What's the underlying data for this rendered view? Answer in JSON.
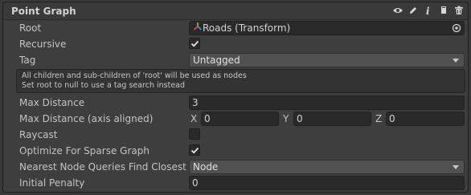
{
  "header": {
    "title": "Point Graph"
  },
  "fields": {
    "root": {
      "label": "Root",
      "value": "Roads (Transform)"
    },
    "recursive": {
      "label": "Recursive",
      "checked": true
    },
    "tag": {
      "label": "Tag",
      "value": "Untagged"
    },
    "help": {
      "line1": "All children and sub-children of 'root' will be used as nodes",
      "line2": "Set root to null to use a tag search instead"
    },
    "max_distance": {
      "label": "Max Distance",
      "value": "3"
    },
    "max_distance_axis": {
      "label": "Max Distance (axis aligned)",
      "x_label": "X",
      "x_value": "0",
      "y_label": "Y",
      "y_value": "0",
      "z_label": "Z",
      "z_value": "0"
    },
    "raycast": {
      "label": "Raycast",
      "checked": false
    },
    "optimize": {
      "label": "Optimize For Sparse Graph",
      "checked": true
    },
    "nearest": {
      "label": "Nearest Node Queries Find Closest",
      "value": "Node"
    },
    "penalty": {
      "label": "Initial Penalty",
      "value": "0"
    }
  },
  "icons": [
    "eye-icon",
    "pencil-icon",
    "info-icon",
    "copy-icon",
    "trash-icon",
    "transform-icon",
    "object-picker-icon",
    "dropdown-arrow-icon",
    "checkmark-icon"
  ]
}
